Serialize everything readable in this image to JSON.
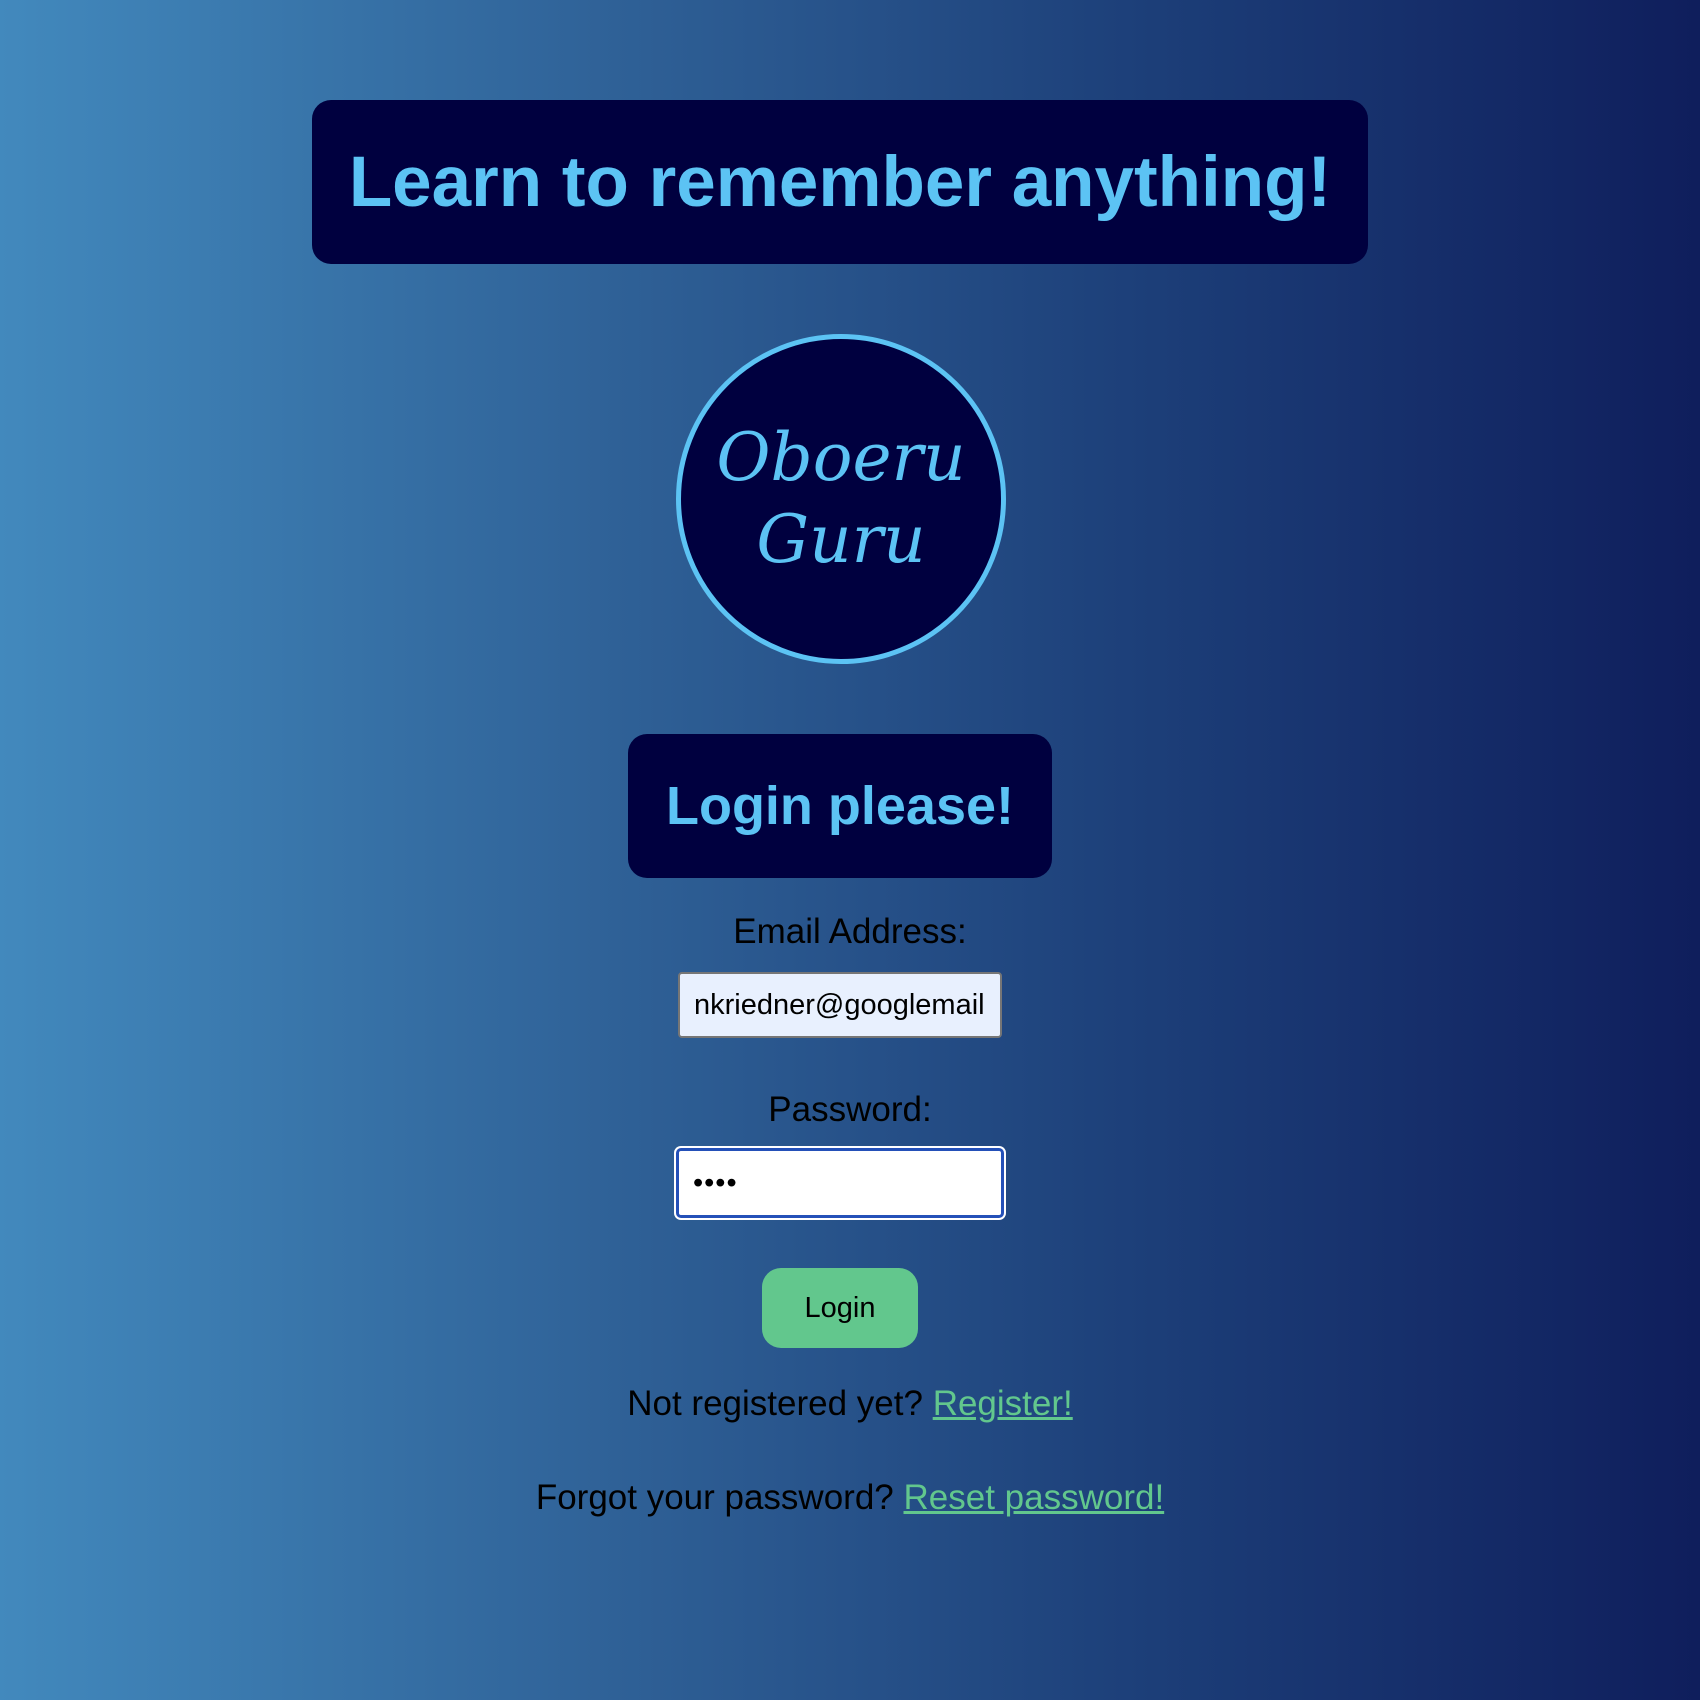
{
  "headline": "Learn to remember anything!",
  "logo": {
    "line1": "Oboeru",
    "line2": "Guru"
  },
  "login_heading": "Login please!",
  "form": {
    "email_label": "Email Address:",
    "email_value": "nkriedner@googlemail",
    "password_label": "Password:",
    "password_value": "••••",
    "login_button": "Login"
  },
  "register": {
    "prompt": "Not registered yet?",
    "link": "Register!"
  },
  "reset": {
    "prompt": "Forgot your password?",
    "link": "Reset password!"
  },
  "colors": {
    "panel": "#00003f",
    "accent_text": "#5cc3f4",
    "button_green": "#62c78d",
    "link_green": "#62c78d"
  }
}
